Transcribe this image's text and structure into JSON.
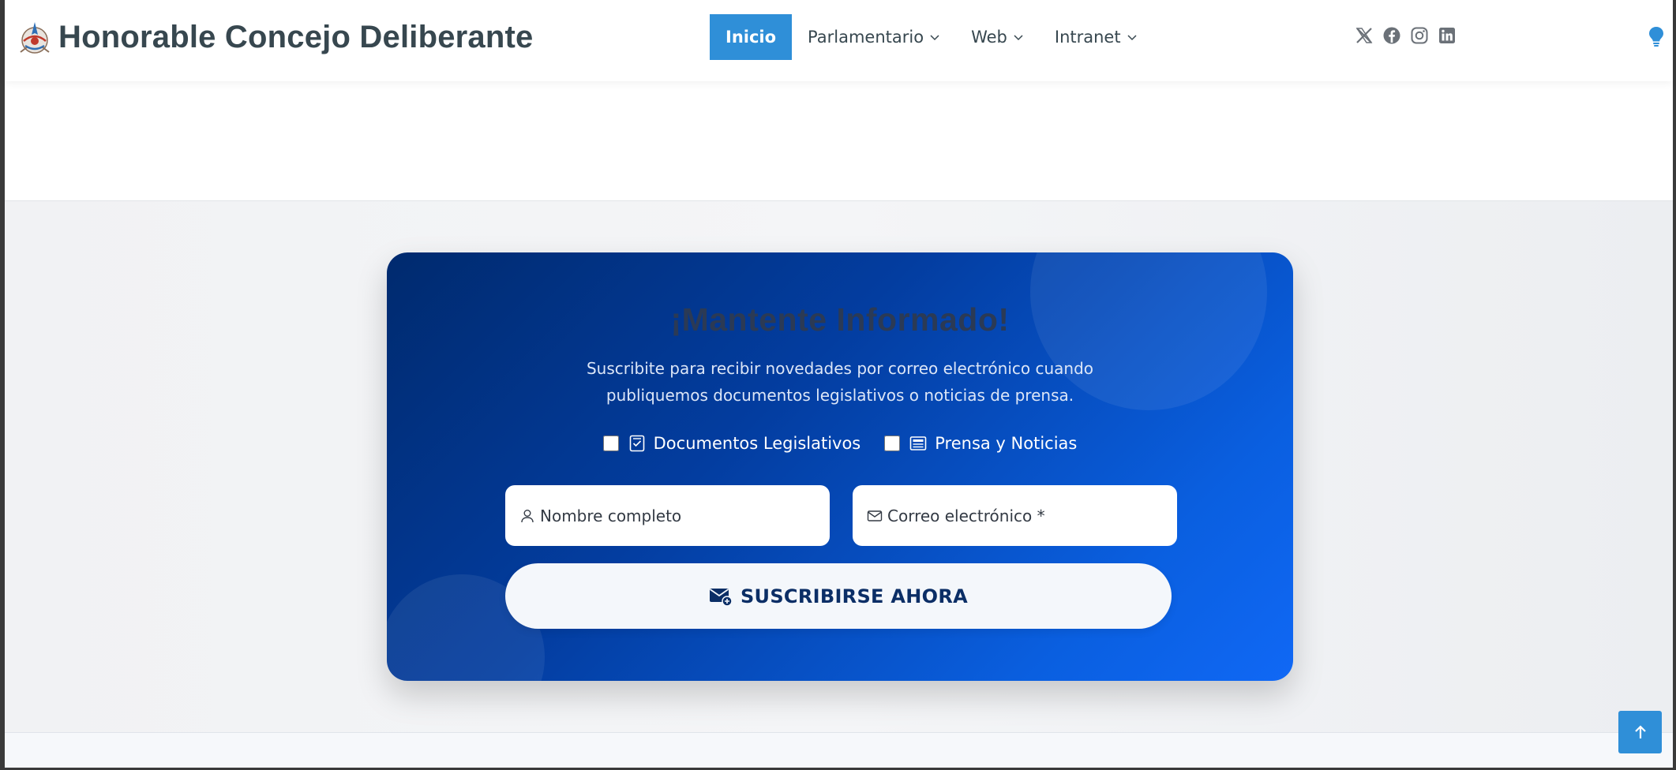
{
  "header": {
    "site_title": "Honorable Concejo Deliberante",
    "logo_icon": "municipal-logo",
    "nav": [
      {
        "label": "Inicio",
        "active": true
      },
      {
        "label": "Parlamentario",
        "dropdown": true
      },
      {
        "label": "Web",
        "dropdown": true
      },
      {
        "label": "Intranet",
        "dropdown": true
      }
    ],
    "social_icons": [
      "x-icon",
      "facebook-icon",
      "instagram-icon",
      "linkedin-icon"
    ],
    "theme_toggle_icon": "lightbulb-icon",
    "accent_color": "#2f8fd8"
  },
  "subscribe_card": {
    "title": "¡Mantente Informado!",
    "subtitle": "Suscribite para recibir novedades por correo electrónico cuando publiquemos documentos legislativos o noticias de prensa.",
    "options": [
      {
        "label": "Documentos Legislativos",
        "icon": "checklist-icon",
        "checked": false
      },
      {
        "label": "Prensa y Noticias",
        "icon": "newspaper-icon",
        "checked": false
      }
    ],
    "name_placeholder": "Nombre completo",
    "email_placeholder": "Correo electrónico *",
    "submit_label": "SUSCRIBIRSE AHORA",
    "gradient_start": "#002a6e",
    "gradient_end": "#1068f5"
  },
  "scroll_top_icon": "arrow-up-icon"
}
